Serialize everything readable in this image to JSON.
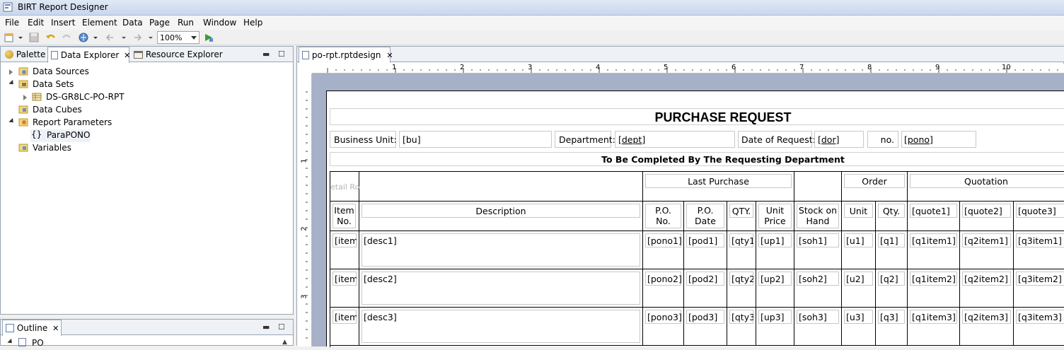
{
  "window": {
    "title": "BIRT Report Designer"
  },
  "menu": [
    "File",
    "Edit",
    "Insert",
    "Element",
    "Data",
    "Page",
    "Run",
    "Window",
    "Help"
  ],
  "toolbar": {
    "zoom": "100%"
  },
  "left_tabs": {
    "palette": "Palette",
    "data_explorer": "Data Explorer",
    "resource_explorer": "Resource Explorer"
  },
  "tree": {
    "data_sources": "Data Sources",
    "data_sets": "Data Sets",
    "dataset_item": "DS-GR8LC-PO-RPT",
    "data_cubes": "Data Cubes",
    "report_parameters": "Report Parameters",
    "param_item": "ParaPONO",
    "variables": "Variables"
  },
  "outline": {
    "tab": "Outline",
    "root": "PO"
  },
  "editor": {
    "tab": "po-rpt.rptdesign"
  },
  "ruler": {
    "h": [
      "1",
      "2",
      "3",
      "4",
      "5",
      "6",
      "7",
      "8",
      "9",
      "10"
    ],
    "v": [
      "1",
      "2",
      "3"
    ]
  },
  "report": {
    "title": "PURCHASE REQUEST",
    "header": {
      "bu_label": "Business Unit:",
      "bu_value": "[bu]",
      "dept_label": "Department:",
      "dept_value": "[dept]",
      "dor_label": "Date of Request:",
      "dor_value": "[dor]",
      "no_label": "no.",
      "no_value": "[pono]"
    },
    "subtitle": "To Be Completed By The Requesting Department",
    "detail_row_label": "etail Ro",
    "groups": {
      "last_purchase": "Last Purchase",
      "order": "Order",
      "quotation": "Quotation"
    },
    "columns": {
      "item_no_1": "Item",
      "item_no_2": "No.",
      "description": "Description",
      "po_no_1": "P.O.",
      "po_no_2": "No.",
      "po_date_1": "P.O.",
      "po_date_2": "Date",
      "qty": "QTY.",
      "unit_price_1": "Unit",
      "unit_price_2": "Price",
      "soh_1": "Stock on",
      "soh_2": "Hand",
      "unit": "Unit",
      "order_qty": "Qty.",
      "quote1": "[quote1]",
      "quote2": "[quote2]",
      "quote3": "[quote3]"
    },
    "rows": [
      {
        "item": "[item",
        "desc": "[desc1]",
        "pono": "[pono1]",
        "pod": "[pod1]",
        "qty": "[qty1]",
        "up": "[up1]",
        "soh": "[soh1]",
        "u": "[u1]",
        "q": "[q1]",
        "qi1": "[q1item1]",
        "qi2": "[q2item1]",
        "qi3": "[q3item1]"
      },
      {
        "item": "[item",
        "desc": "[desc2]",
        "pono": "[pono2]",
        "pod": "[pod2]",
        "qty": "[qty2]",
        "up": "[up2]",
        "soh": "[soh2]",
        "u": "[u2]",
        "q": "[q2]",
        "qi1": "[q1item2]",
        "qi2": "[q2item2]",
        "qi3": "[q3item2]"
      },
      {
        "item": "[item",
        "desc": "[desc3]",
        "pono": "[pono3]",
        "pod": "[pod3]",
        "qty": "[qty3]",
        "up": "[up3]",
        "soh": "[soh3]",
        "u": "[u3]",
        "q": "[q3]",
        "qi1": "[q1item3]",
        "qi2": "[q2item3]",
        "qi3": "[q3item3]"
      }
    ]
  }
}
